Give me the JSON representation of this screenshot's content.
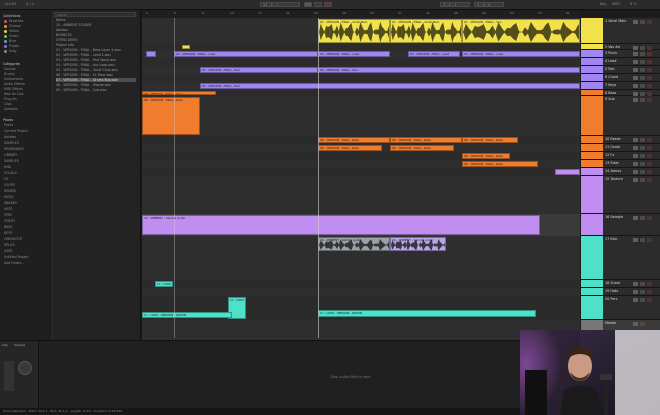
{
  "topbar": {
    "tempo": "114.00",
    "time_sig": "4 / 4",
    "position": "41 . 1 . 1",
    "loop_start": "1 . 1 . 1",
    "loop_length": "4 . 0 . 0",
    "key": "Key",
    "midi": "MIDI",
    "cpu": "8 %"
  },
  "browser": {
    "search_placeholder": "Search",
    "collections_heading": "Collections",
    "collections": [
      {
        "label": "Favorites",
        "color": "#e05555"
      },
      {
        "label": "Orange",
        "color": "#e8923a"
      },
      {
        "label": "Yellow",
        "color": "#e6d23a"
      },
      {
        "label": "Green",
        "color": "#7bc34d"
      },
      {
        "label": "Blue",
        "color": "#4aa3e6"
      },
      {
        "label": "Purple",
        "color": "#9a6be0"
      },
      {
        "label": "Gray",
        "color": "#8a8a8a"
      }
    ],
    "categories_heading": "Categories",
    "categories": [
      "Sounds",
      "Drums",
      "Instruments",
      "Audio Effects",
      "MIDI Effects",
      "Max for Live",
      "Plug-Ins",
      "Clips",
      "Samples"
    ],
    "places_heading": "Places",
    "places": [
      "Packs",
      "Current Project",
      "Ableton",
      "SAMPLES",
      "VENGEANCE",
      "LIBRARY",
      "SAMPLES",
      "MIDI",
      "VOCALS",
      "FX",
      "LOOPS",
      "DRUMS",
      "KICKS",
      "SNARES",
      "HATS",
      "PERC",
      "SYNTH",
      "BASS",
      "KEYS",
      "ONESHOTS",
      "SPLICE",
      "USER",
      "Untitled Project",
      "Add Folder..."
    ],
    "files": [
      "Name",
      "10 - AMBIENT FOLDER",
      "Ableton",
      "BOUNCES",
      "STEMS DEMO",
      "Project Info",
      "01 - VERSION - FINAL - Bass Layer 2.wav",
      "02 - VERSION - FINAL - Lead 2.wav",
      "03 - VERSION - FINAL - Pad Stack.wav",
      "04 - VERSION - FINAL - Arp Loop.wav",
      "05 - VERSION - FINAL - Vocal Chop.wav",
      "06 - VERSION - FINAL - Fx Riser.wav",
      "07 - VERSION - FINAL - Drums Bus.wav",
      "08 - VERSION - FINAL - Master.wav",
      "09 - VERSION - FINAL - Sub.wav"
    ],
    "selected_index": 12
  },
  "ruler": [
    "1",
    "5",
    "9",
    "13",
    "17",
    "21",
    "25",
    "29",
    "33",
    "37",
    "41",
    "45",
    "49",
    "53",
    "57",
    "61"
  ],
  "tracks": [
    {
      "name": "1 Vocal Main",
      "color": "#f2e14a"
    },
    {
      "name": "2 Vox Ad",
      "color": "#f2e14a"
    },
    {
      "name": "3 Pluck",
      "color": "#9f86f0"
    },
    {
      "name": "4 Lead",
      "color": "#9f86f0"
    },
    {
      "name": "5 Pad",
      "color": "#9f86f0"
    },
    {
      "name": "6 Chord",
      "color": "#9f86f0"
    },
    {
      "name": "7 Keys",
      "color": "#9f86f0"
    },
    {
      "name": "8 Bass",
      "color": "#f07c2e"
    },
    {
      "name": "9 Sub",
      "color": "#f07c2e"
    },
    {
      "name": "10 Reese",
      "color": "#f07c2e"
    },
    {
      "name": "11 Growl",
      "color": "#f07c2e"
    },
    {
      "name": "12 Fx",
      "color": "#f07c2e"
    },
    {
      "name": "13 Riser",
      "color": "#f07c2e"
    },
    {
      "name": "14 Atmos",
      "color": "#c08ef0"
    },
    {
      "name": "15 Texture",
      "color": "#c08ef0"
    },
    {
      "name": "16 Sample",
      "color": "#c08ef0"
    },
    {
      "name": "17 Kick",
      "color": "#4ee0c8"
    },
    {
      "name": "18 Snare",
      "color": "#4ee0c8"
    },
    {
      "name": "19 Hats",
      "color": "#4ee0c8"
    },
    {
      "name": "20 Perc",
      "color": "#4ee0c8"
    },
    {
      "name": "Master",
      "color": "#777777"
    }
  ],
  "clip_names": {
    "vocal_a": "01 - VERSION - FINAL - Vocal Main",
    "vocal_b": "01 - VERSION - FINAL - Vox",
    "lead": "03 - VERSION - FINAL - Lead",
    "pad": "05 - VERSION - FINAL - Pad",
    "bass": "08 - VERSION - FINAL - Bass",
    "sample": "16 - AMBIENT - Sample Audio",
    "drums": "17 - LOOP - VERSION - DRUMS"
  },
  "detail": {
    "hint": "Drop Audio Effects Here",
    "clip_label": "Clip",
    "sample_label": "Sample"
  },
  "status": {
    "text": "Track Selection - Start: 33.1.1 - End: 41.1.1 - Length: 8.0.0 - Duration: 0:16:842"
  }
}
